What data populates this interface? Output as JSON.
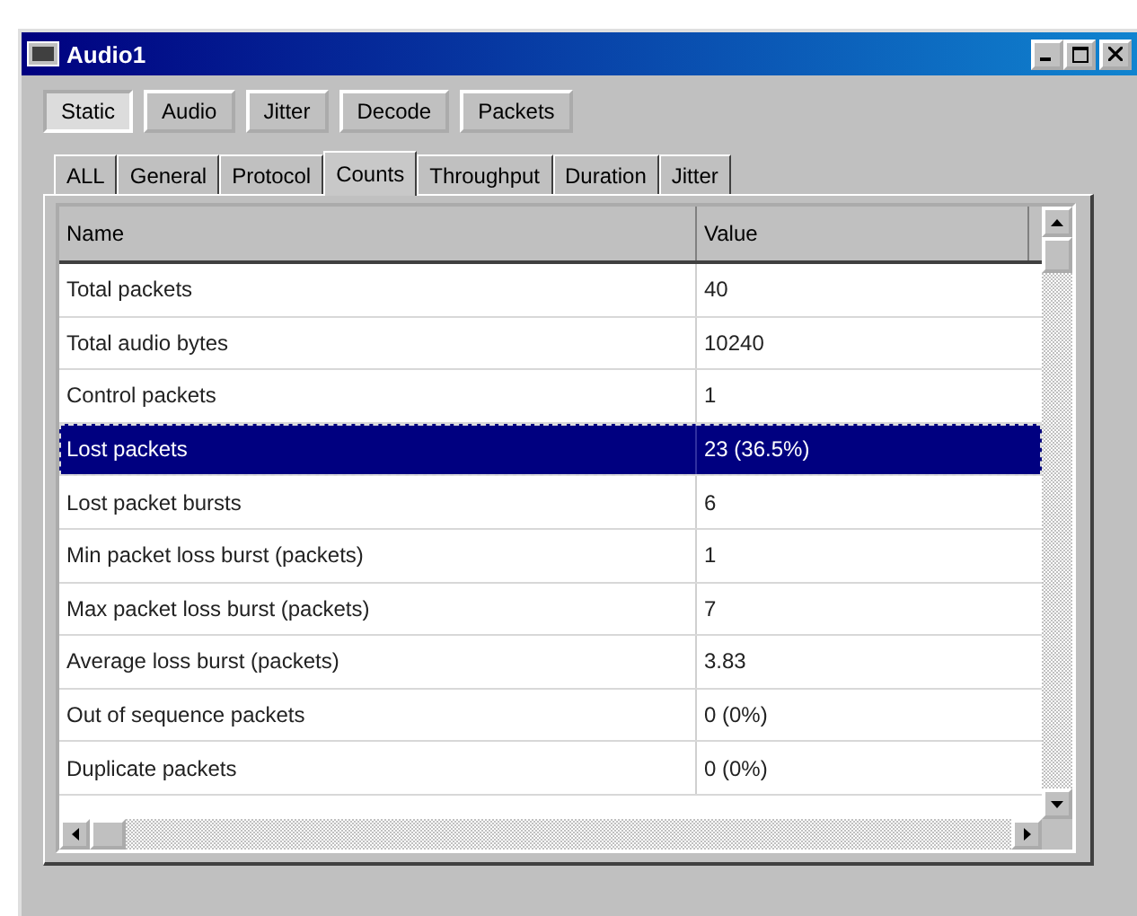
{
  "window": {
    "title": "Audio1"
  },
  "views": [
    {
      "label": "Static",
      "selected": true
    },
    {
      "label": "Audio",
      "selected": false
    },
    {
      "label": "Jitter",
      "selected": false
    },
    {
      "label": "Decode",
      "selected": false
    },
    {
      "label": "Packets",
      "selected": false
    }
  ],
  "tabs": [
    {
      "label": "ALL",
      "selected": false
    },
    {
      "label": "General",
      "selected": false
    },
    {
      "label": "Protocol",
      "selected": false
    },
    {
      "label": "Counts",
      "selected": true
    },
    {
      "label": "Throughput",
      "selected": false
    },
    {
      "label": "Duration",
      "selected": false
    },
    {
      "label": "Jitter",
      "selected": false
    }
  ],
  "table": {
    "columns": [
      "Name",
      "Value"
    ],
    "rows": [
      {
        "name": "Total packets",
        "value": "40",
        "selected": false
      },
      {
        "name": "Total audio bytes",
        "value": "10240",
        "selected": false
      },
      {
        "name": "Control packets",
        "value": "1",
        "selected": false
      },
      {
        "name": "Lost packets",
        "value": "23 (36.5%)",
        "selected": true
      },
      {
        "name": "Lost packet bursts",
        "value": "6",
        "selected": false
      },
      {
        "name": "Min packet loss burst (packets)",
        "value": "1",
        "selected": false
      },
      {
        "name": "Max packet loss burst (packets)",
        "value": "7",
        "selected": false
      },
      {
        "name": "Average loss burst (packets)",
        "value": "3.83",
        "selected": false
      },
      {
        "name": "Out of sequence packets",
        "value": "0 (0%)",
        "selected": false
      },
      {
        "name": "Duplicate packets",
        "value": "0 (0%)",
        "selected": false
      }
    ]
  }
}
